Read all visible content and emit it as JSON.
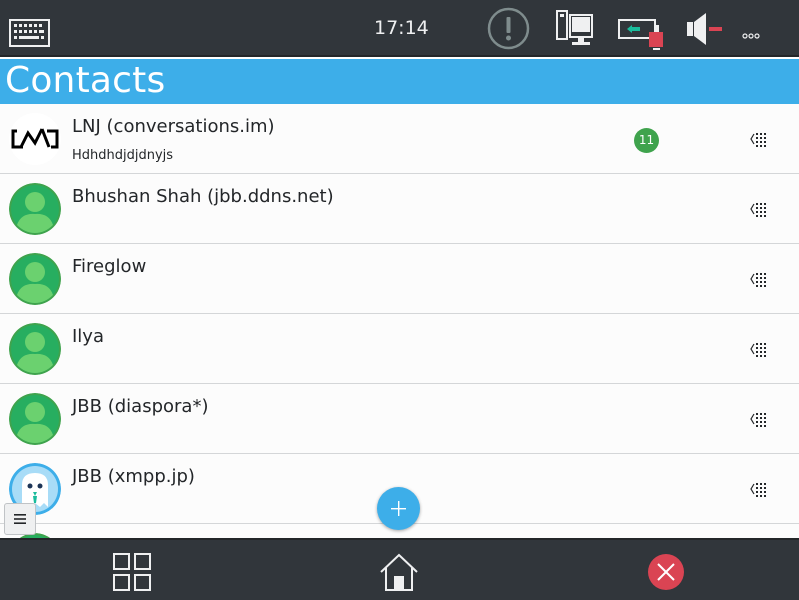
{
  "statusbar": {
    "time": "17:14",
    "icons": [
      "keyboard-icon",
      "alert-icon",
      "network-icon",
      "battery-icon",
      "volume-muted-icon",
      "more-icon"
    ]
  },
  "header": {
    "title": "Contacts"
  },
  "contacts": [
    {
      "name": "LNJ (conversations.im)",
      "status": "Hdhdhdjdjdnyjs",
      "unread": "11",
      "avatar": "lnj-logo"
    },
    {
      "name": "Bhushan Shah (jbb.ddns.net)",
      "status": "",
      "unread": "",
      "avatar": "default-user"
    },
    {
      "name": "Fireglow",
      "status": "",
      "unread": "",
      "avatar": "default-user"
    },
    {
      "name": "Ilya",
      "status": "",
      "unread": "",
      "avatar": "default-user"
    },
    {
      "name": "JBB (diaspora*)",
      "status": "",
      "unread": "",
      "avatar": "default-user"
    },
    {
      "name": "JBB (xmpp.jp)",
      "status": "",
      "unread": "",
      "avatar": "ghost-avatar"
    }
  ],
  "colors": {
    "accent": "#3daee9",
    "bar": "#31363b",
    "badge": "#3fa34d",
    "close": "#da4453",
    "avatar_green": "#3fa34d"
  },
  "bottombar": {
    "icons": [
      "apps-grid-icon",
      "home-icon",
      "close-icon"
    ]
  }
}
